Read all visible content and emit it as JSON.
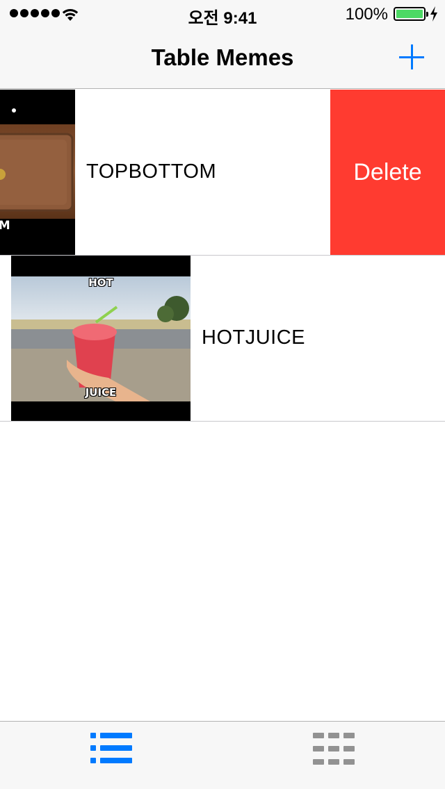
{
  "status_bar": {
    "time": "오전 9:41",
    "battery_percent": "100%",
    "battery_level": 1.0,
    "signal_bars": 5
  },
  "nav": {
    "title": "Table Memes",
    "add_icon": "plus-icon"
  },
  "rows": [
    {
      "label": "TOPBOTTOM",
      "swiped": true,
      "delete_label": "Delete",
      "meme_bottom_text": "OM"
    },
    {
      "label": "HOTJUICE",
      "swiped": false,
      "meme_top_text": "HOT",
      "meme_bottom_text": "JUICE"
    }
  ],
  "tab_bar": {
    "tabs": [
      {
        "icon": "list-icon",
        "selected": true
      },
      {
        "icon": "grid-icon",
        "selected": false
      }
    ]
  },
  "colors": {
    "accent": "#007aff",
    "delete": "#ff3b30",
    "battery": "#4cd964",
    "inactive_tab": "#929292"
  }
}
